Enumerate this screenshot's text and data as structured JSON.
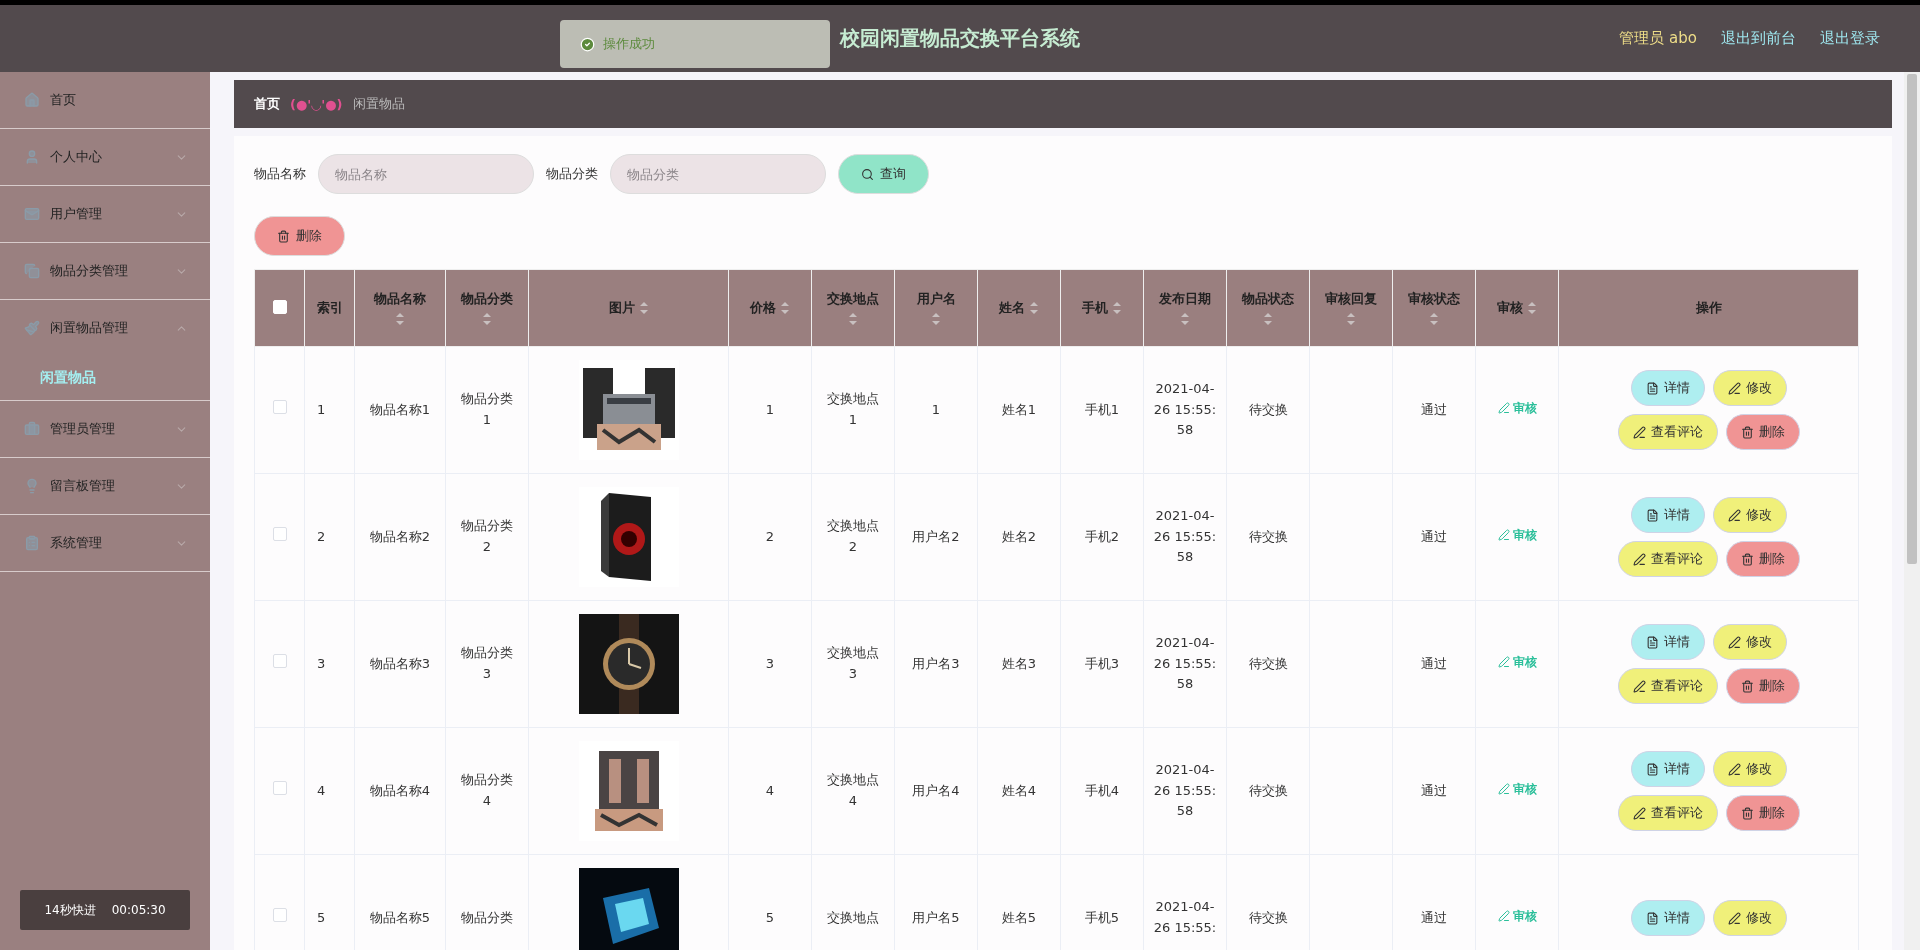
{
  "header": {
    "title": "校园闲置物品交换平台系统",
    "toast": "操作成功",
    "user_label": "管理员 abo",
    "links": [
      "退出到前台",
      "退出登录"
    ]
  },
  "sidebar": {
    "items": [
      {
        "label": "首页",
        "kind": "link"
      },
      {
        "label": "个人中心",
        "kind": "menu",
        "expanded": false
      },
      {
        "label": "用户管理",
        "kind": "menu",
        "expanded": false
      },
      {
        "label": "物品分类管理",
        "kind": "menu",
        "expanded": false
      },
      {
        "label": "闲置物品管理",
        "kind": "menu",
        "expanded": true,
        "children": [
          {
            "label": "闲置物品",
            "selected": true
          }
        ]
      },
      {
        "label": "管理员管理",
        "kind": "menu",
        "expanded": false
      },
      {
        "label": "留言板管理",
        "kind": "menu",
        "expanded": false
      },
      {
        "label": "系统管理",
        "kind": "menu",
        "expanded": false
      }
    ],
    "timer": {
      "label": "14秒快进",
      "time": "00:05:30"
    }
  },
  "breadcrumb": {
    "home": "首页",
    "separator": "(●'◡'●)",
    "current": "闲置物品"
  },
  "search": {
    "fields": [
      {
        "label": "物品名称",
        "placeholder": "物品名称"
      },
      {
        "label": "物品分类",
        "placeholder": "物品分类"
      }
    ],
    "button": "查询",
    "delete_button": "删除"
  },
  "table": {
    "select_all": {
      "checked": false
    },
    "columns": [
      {
        "label": "索引",
        "sortable": false
      },
      {
        "label": "物品名称",
        "sortable": true
      },
      {
        "label": "物品分类",
        "sortable": true
      },
      {
        "label": "图片",
        "sortable": true
      },
      {
        "label": "价格",
        "sortable": true
      },
      {
        "label": "交换地点",
        "sortable": true
      },
      {
        "label": "用户名",
        "sortable": true
      },
      {
        "label": "姓名",
        "sortable": true
      },
      {
        "label": "手机",
        "sortable": true
      },
      {
        "label": "发布日期",
        "sortable": true
      },
      {
        "label": "物品状态",
        "sortable": true
      },
      {
        "label": "审核回复",
        "sortable": true
      },
      {
        "label": "审核状态",
        "sortable": true
      },
      {
        "label": "审核",
        "sortable": true
      },
      {
        "label": "操作",
        "sortable": false
      }
    ],
    "rows": [
      {
        "checked": false,
        "index": "1",
        "name": "物品名称1",
        "category": "物品分类1",
        "picture": {
          "kind": "picture"
        },
        "price": "1",
        "location": "交换地点1",
        "username": "1",
        "realname": "姓名1",
        "phone": "手机1",
        "date": "2021-04-26 15:55:58",
        "item_status": "待交换",
        "review_status": "通过",
        "review_link": "审核",
        "actions": [
          {
            "label": "详情",
            "kind": "detail"
          },
          {
            "label": "修改",
            "kind": "edit"
          },
          {
            "label": "查看评论",
            "kind": "comments"
          },
          {
            "label": "删除",
            "kind": "delete"
          }
        ]
      },
      {
        "checked": false,
        "index": "2",
        "name": "物品名称2",
        "category": "物品分类2",
        "picture": {
          "kind": "picture"
        },
        "price": "2",
        "location": "交换地点2",
        "username": "用户名2",
        "realname": "姓名2",
        "phone": "手机2",
        "date": "2021-04-26 15:55:58",
        "item_status": "待交换",
        "review_status": "通过",
        "review_link": "审核",
        "actions": [
          {
            "label": "详情",
            "kind": "detail"
          },
          {
            "label": "修改",
            "kind": "edit"
          },
          {
            "label": "查看评论",
            "kind": "comments"
          },
          {
            "label": "删除",
            "kind": "delete"
          }
        ]
      },
      {
        "checked": false,
        "index": "3",
        "name": "物品名称3",
        "category": "物品分类3",
        "picture": {
          "kind": "picture"
        },
        "price": "3",
        "location": "交换地点3",
        "username": "用户名3",
        "realname": "姓名3",
        "phone": "手机3",
        "date": "2021-04-26 15:55:58",
        "item_status": "待交换",
        "review_status": "通过",
        "review_link": "审核",
        "actions": [
          {
            "label": "详情",
            "kind": "detail"
          },
          {
            "label": "修改",
            "kind": "edit"
          },
          {
            "label": "查看评论",
            "kind": "comments"
          },
          {
            "label": "删除",
            "kind": "delete"
          }
        ]
      },
      {
        "checked": false,
        "index": "4",
        "name": "物品名称4",
        "category": "物品分类4",
        "picture": {
          "kind": "picture"
        },
        "price": "4",
        "location": "交换地点4",
        "username": "用户名4",
        "realname": "姓名4",
        "phone": "手机4",
        "date": "2021-04-26 15:55:58",
        "item_status": "待交换",
        "review_status": "通过",
        "review_link": "审核",
        "actions": [
          {
            "label": "详情",
            "kind": "detail"
          },
          {
            "label": "修改",
            "kind": "edit"
          },
          {
            "label": "查看评论",
            "kind": "comments"
          },
          {
            "label": "删除",
            "kind": "delete"
          }
        ]
      },
      {
        "checked": false,
        "index": "5",
        "name": "物品名称5",
        "category": "物品分类",
        "picture": {
          "kind": "picture"
        },
        "price": "5",
        "location": "交换地点",
        "username": "用户名5",
        "realname": "姓名5",
        "phone": "手机5",
        "date": "2021-04-26 15:55:",
        "item_status": "待交换",
        "review_status": "通过",
        "review_link": "审核",
        "actions": [
          {
            "label": "详情",
            "kind": "detail"
          },
          {
            "label": "修改",
            "kind": "edit"
          }
        ]
      }
    ]
  }
}
